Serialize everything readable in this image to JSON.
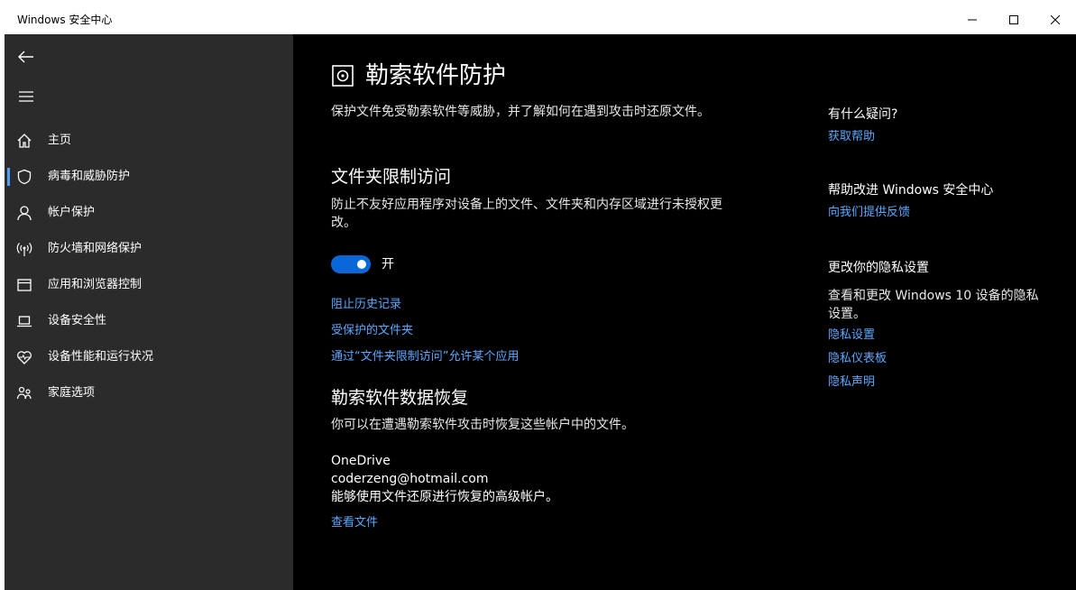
{
  "window": {
    "title": "Windows 安全中心",
    "controls": [
      "minimize",
      "maximize",
      "close"
    ]
  },
  "sidebar": {
    "back_icon": "back-arrow-icon",
    "menu_icon": "hamburger-icon",
    "items": [
      {
        "label": "主页",
        "icon": "home-icon"
      },
      {
        "label": "病毒和威胁防护",
        "icon": "shield-icon",
        "selected": true
      },
      {
        "label": "帐户保护",
        "icon": "person-icon"
      },
      {
        "label": "防火墙和网络保护",
        "icon": "wifi-antenna-icon"
      },
      {
        "label": "应用和浏览器控制",
        "icon": "browser-window-icon"
      },
      {
        "label": "设备安全性",
        "icon": "laptop-icon"
      },
      {
        "label": "设备性能和运行状况",
        "icon": "heart-pulse-icon"
      },
      {
        "label": "家庭选项",
        "icon": "family-icon"
      }
    ]
  },
  "main": {
    "title": "勒索软件防护",
    "title_icon": "ransomware-protection-icon",
    "subtitle": "保护文件免受勒索软件等威胁，并了解如何在遇到攻击时还原文件。",
    "cfa": {
      "heading": "文件夹限制访问",
      "description_line1": "防止不友好应用程序对设备上的文件、文件夹和内存区域进行未授权更",
      "description_line2": "改。",
      "toggle_label": "开",
      "toggle_on": true,
      "links": [
        "阻止历史记录",
        "受保护的文件夹",
        "通过“文件夹限制访问”允许某个应用"
      ]
    },
    "recovery": {
      "heading": "勒索软件数据恢复",
      "description": "你可以在遭遇勒索软件攻击时恢复这些帐户中的文件。",
      "provider": "OneDrive",
      "account": "coderzeng@hotmail.com",
      "account_note": "能够使用文件还原进行恢复的高级帐户。",
      "link": "查看文件"
    }
  },
  "right": {
    "help": {
      "heading": "有什么疑问?",
      "link": "获取帮助"
    },
    "improve": {
      "heading": "帮助改进 Windows 安全中心",
      "link": "向我们提供反馈"
    },
    "privacy": {
      "heading": "更改你的隐私设置",
      "desc_line1": "查看和更改 Windows 10 设备的隐私",
      "desc_line2": "设置。",
      "links": [
        "隐私设置",
        "隐私仪表板",
        "隐私声明"
      ]
    }
  },
  "colors": {
    "accent": "#0a67d8",
    "link": "#5ba8ff",
    "sidebar_bg": "#2b2b2b",
    "bg": "#000000"
  }
}
